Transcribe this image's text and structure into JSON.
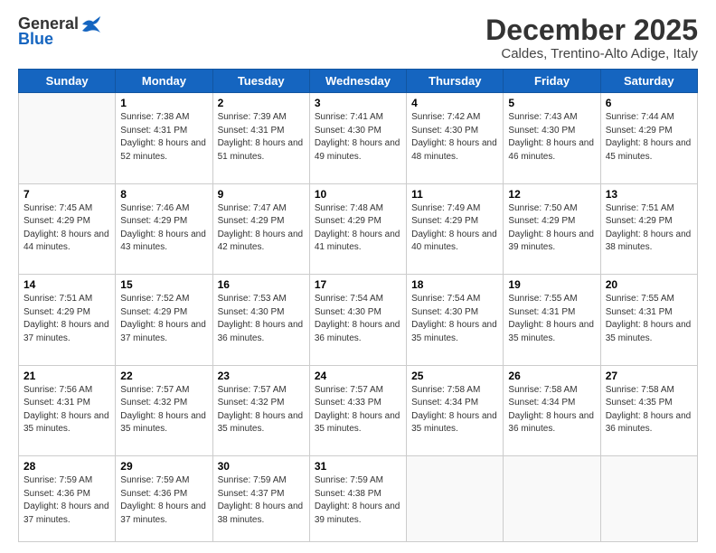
{
  "logo": {
    "line1": "General",
    "line2": "Blue"
  },
  "title": "December 2025",
  "location": "Caldes, Trentino-Alto Adige, Italy",
  "days_of_week": [
    "Sunday",
    "Monday",
    "Tuesday",
    "Wednesday",
    "Thursday",
    "Friday",
    "Saturday"
  ],
  "weeks": [
    [
      {
        "day": "",
        "sunrise": "",
        "sunset": "",
        "daylight": ""
      },
      {
        "day": "1",
        "sunrise": "Sunrise: 7:38 AM",
        "sunset": "Sunset: 4:31 PM",
        "daylight": "Daylight: 8 hours and 52 minutes."
      },
      {
        "day": "2",
        "sunrise": "Sunrise: 7:39 AM",
        "sunset": "Sunset: 4:31 PM",
        "daylight": "Daylight: 8 hours and 51 minutes."
      },
      {
        "day": "3",
        "sunrise": "Sunrise: 7:41 AM",
        "sunset": "Sunset: 4:30 PM",
        "daylight": "Daylight: 8 hours and 49 minutes."
      },
      {
        "day": "4",
        "sunrise": "Sunrise: 7:42 AM",
        "sunset": "Sunset: 4:30 PM",
        "daylight": "Daylight: 8 hours and 48 minutes."
      },
      {
        "day": "5",
        "sunrise": "Sunrise: 7:43 AM",
        "sunset": "Sunset: 4:30 PM",
        "daylight": "Daylight: 8 hours and 46 minutes."
      },
      {
        "day": "6",
        "sunrise": "Sunrise: 7:44 AM",
        "sunset": "Sunset: 4:29 PM",
        "daylight": "Daylight: 8 hours and 45 minutes."
      }
    ],
    [
      {
        "day": "7",
        "sunrise": "Sunrise: 7:45 AM",
        "sunset": "Sunset: 4:29 PM",
        "daylight": "Daylight: 8 hours and 44 minutes."
      },
      {
        "day": "8",
        "sunrise": "Sunrise: 7:46 AM",
        "sunset": "Sunset: 4:29 PM",
        "daylight": "Daylight: 8 hours and 43 minutes."
      },
      {
        "day": "9",
        "sunrise": "Sunrise: 7:47 AM",
        "sunset": "Sunset: 4:29 PM",
        "daylight": "Daylight: 8 hours and 42 minutes."
      },
      {
        "day": "10",
        "sunrise": "Sunrise: 7:48 AM",
        "sunset": "Sunset: 4:29 PM",
        "daylight": "Daylight: 8 hours and 41 minutes."
      },
      {
        "day": "11",
        "sunrise": "Sunrise: 7:49 AM",
        "sunset": "Sunset: 4:29 PM",
        "daylight": "Daylight: 8 hours and 40 minutes."
      },
      {
        "day": "12",
        "sunrise": "Sunrise: 7:50 AM",
        "sunset": "Sunset: 4:29 PM",
        "daylight": "Daylight: 8 hours and 39 minutes."
      },
      {
        "day": "13",
        "sunrise": "Sunrise: 7:51 AM",
        "sunset": "Sunset: 4:29 PM",
        "daylight": "Daylight: 8 hours and 38 minutes."
      }
    ],
    [
      {
        "day": "14",
        "sunrise": "Sunrise: 7:51 AM",
        "sunset": "Sunset: 4:29 PM",
        "daylight": "Daylight: 8 hours and 37 minutes."
      },
      {
        "day": "15",
        "sunrise": "Sunrise: 7:52 AM",
        "sunset": "Sunset: 4:29 PM",
        "daylight": "Daylight: 8 hours and 37 minutes."
      },
      {
        "day": "16",
        "sunrise": "Sunrise: 7:53 AM",
        "sunset": "Sunset: 4:30 PM",
        "daylight": "Daylight: 8 hours and 36 minutes."
      },
      {
        "day": "17",
        "sunrise": "Sunrise: 7:54 AM",
        "sunset": "Sunset: 4:30 PM",
        "daylight": "Daylight: 8 hours and 36 minutes."
      },
      {
        "day": "18",
        "sunrise": "Sunrise: 7:54 AM",
        "sunset": "Sunset: 4:30 PM",
        "daylight": "Daylight: 8 hours and 35 minutes."
      },
      {
        "day": "19",
        "sunrise": "Sunrise: 7:55 AM",
        "sunset": "Sunset: 4:31 PM",
        "daylight": "Daylight: 8 hours and 35 minutes."
      },
      {
        "day": "20",
        "sunrise": "Sunrise: 7:55 AM",
        "sunset": "Sunset: 4:31 PM",
        "daylight": "Daylight: 8 hours and 35 minutes."
      }
    ],
    [
      {
        "day": "21",
        "sunrise": "Sunrise: 7:56 AM",
        "sunset": "Sunset: 4:31 PM",
        "daylight": "Daylight: 8 hours and 35 minutes."
      },
      {
        "day": "22",
        "sunrise": "Sunrise: 7:57 AM",
        "sunset": "Sunset: 4:32 PM",
        "daylight": "Daylight: 8 hours and 35 minutes."
      },
      {
        "day": "23",
        "sunrise": "Sunrise: 7:57 AM",
        "sunset": "Sunset: 4:32 PM",
        "daylight": "Daylight: 8 hours and 35 minutes."
      },
      {
        "day": "24",
        "sunrise": "Sunrise: 7:57 AM",
        "sunset": "Sunset: 4:33 PM",
        "daylight": "Daylight: 8 hours and 35 minutes."
      },
      {
        "day": "25",
        "sunrise": "Sunrise: 7:58 AM",
        "sunset": "Sunset: 4:34 PM",
        "daylight": "Daylight: 8 hours and 35 minutes."
      },
      {
        "day": "26",
        "sunrise": "Sunrise: 7:58 AM",
        "sunset": "Sunset: 4:34 PM",
        "daylight": "Daylight: 8 hours and 36 minutes."
      },
      {
        "day": "27",
        "sunrise": "Sunrise: 7:58 AM",
        "sunset": "Sunset: 4:35 PM",
        "daylight": "Daylight: 8 hours and 36 minutes."
      }
    ],
    [
      {
        "day": "28",
        "sunrise": "Sunrise: 7:59 AM",
        "sunset": "Sunset: 4:36 PM",
        "daylight": "Daylight: 8 hours and 37 minutes."
      },
      {
        "day": "29",
        "sunrise": "Sunrise: 7:59 AM",
        "sunset": "Sunset: 4:36 PM",
        "daylight": "Daylight: 8 hours and 37 minutes."
      },
      {
        "day": "30",
        "sunrise": "Sunrise: 7:59 AM",
        "sunset": "Sunset: 4:37 PM",
        "daylight": "Daylight: 8 hours and 38 minutes."
      },
      {
        "day": "31",
        "sunrise": "Sunrise: 7:59 AM",
        "sunset": "Sunset: 4:38 PM",
        "daylight": "Daylight: 8 hours and 39 minutes."
      },
      {
        "day": "",
        "sunrise": "",
        "sunset": "",
        "daylight": ""
      },
      {
        "day": "",
        "sunrise": "",
        "sunset": "",
        "daylight": ""
      },
      {
        "day": "",
        "sunrise": "",
        "sunset": "",
        "daylight": ""
      }
    ]
  ]
}
